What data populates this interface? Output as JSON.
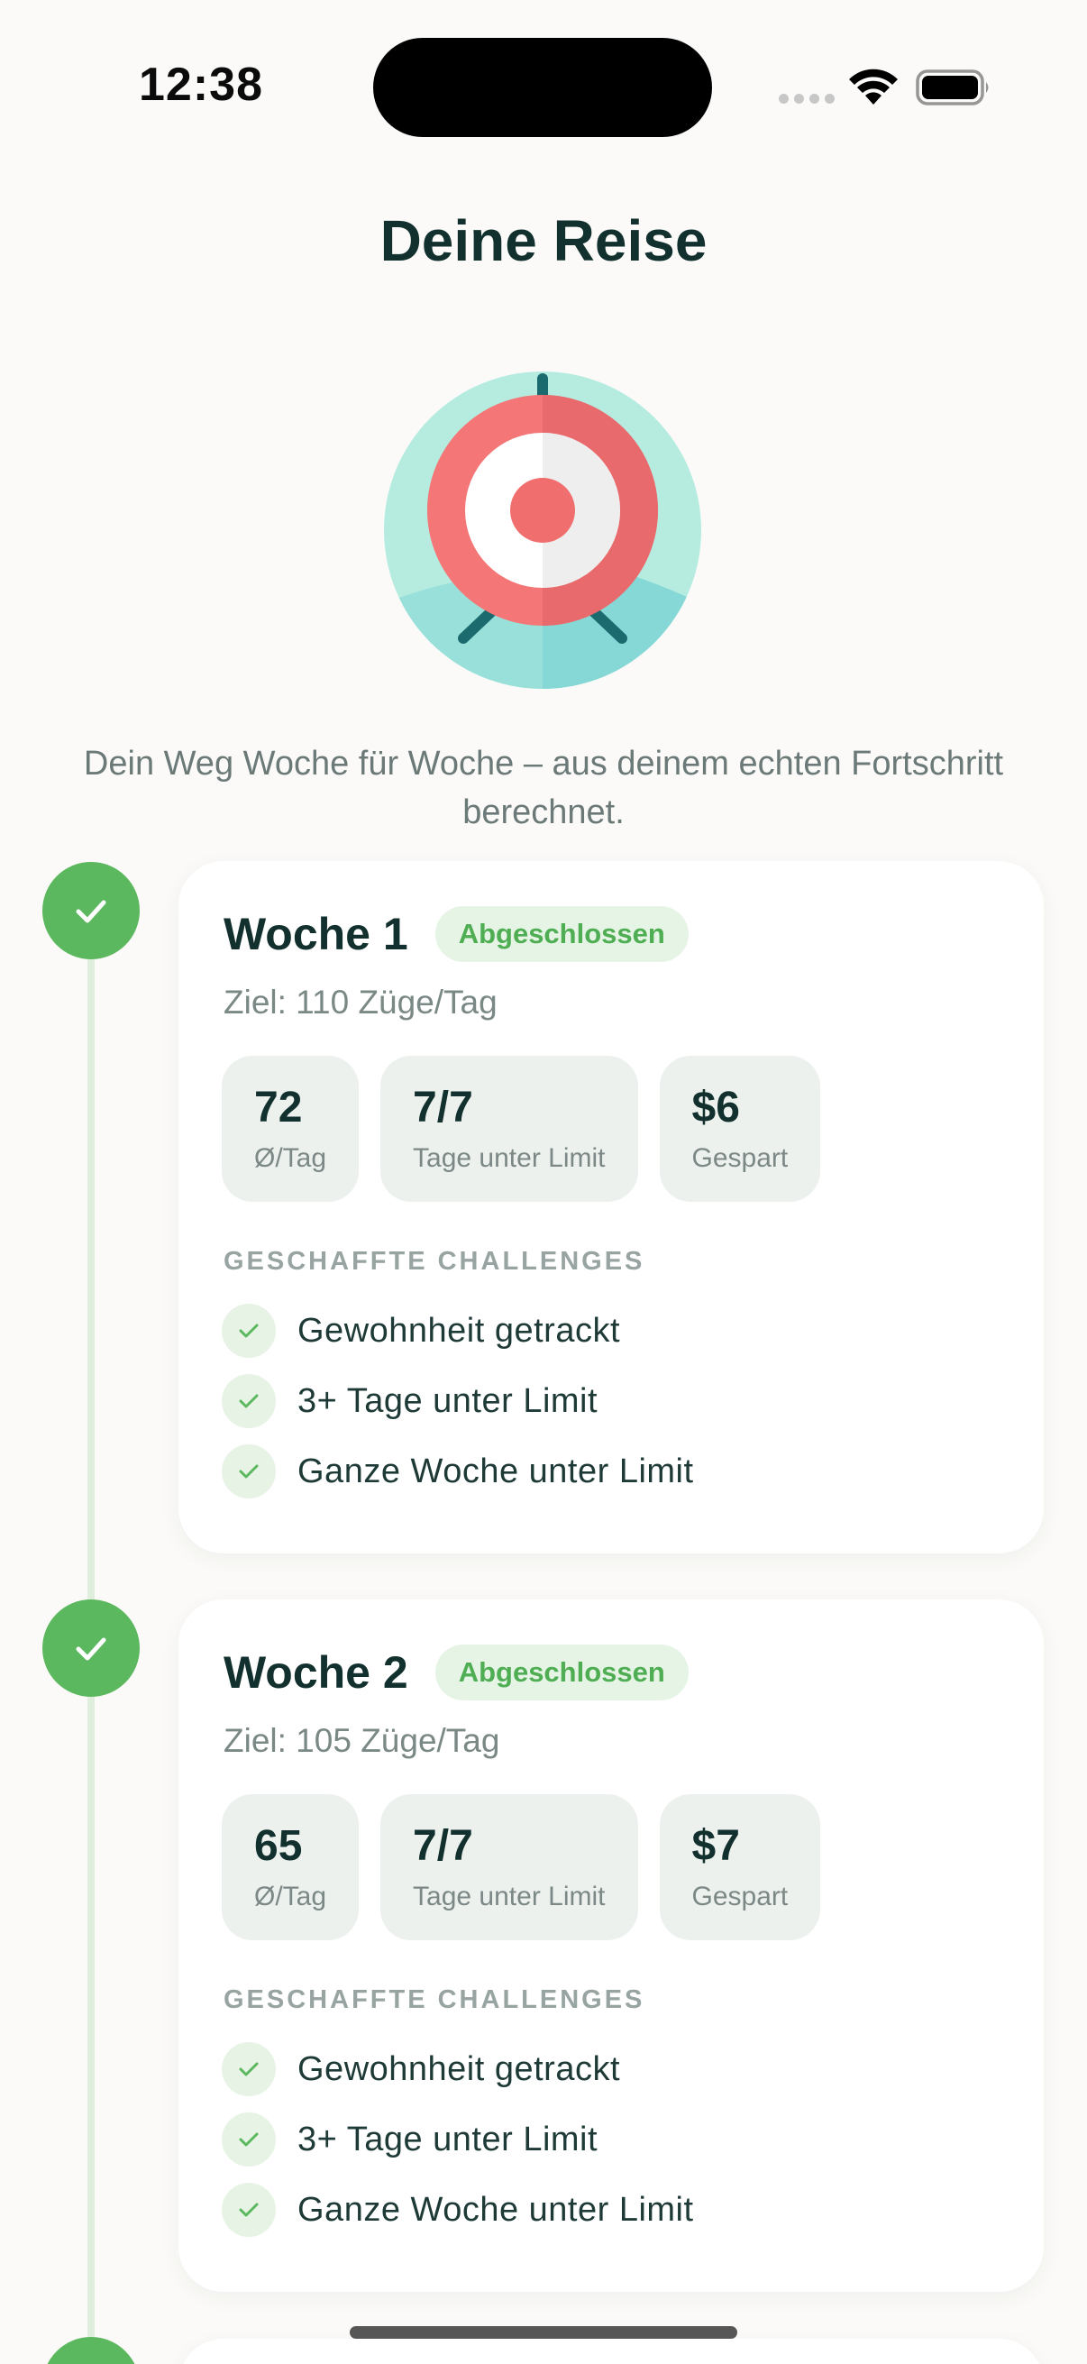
{
  "status_bar": {
    "time": "12:38"
  },
  "header": {
    "title": "Deine Reise"
  },
  "hero": {
    "icon": "target-icon"
  },
  "subtitle": "Dein Weg Woche für Woche – aus deinem echten Fortschritt berechnet.",
  "colors": {
    "accent_green": "#5cb85f",
    "badge_bg": "#e6f4e5",
    "target_red": "#f07171",
    "target_teal": "#b6ece0"
  },
  "weeks": [
    {
      "title": "Woche 1",
      "badge": "Abgeschlossen",
      "goal": "Ziel: 110 Züge/Tag",
      "stats": [
        {
          "value": "72",
          "label": "Ø/Tag"
        },
        {
          "value": "7/7",
          "label": "Tage unter Limit"
        },
        {
          "value": "$6",
          "label": "Gespart"
        }
      ],
      "challenges_label": "GESCHAFFTE CHALLENGES",
      "challenges": [
        "Gewohnheit getrackt",
        "3+ Tage unter Limit",
        "Ganze Woche unter Limit"
      ]
    },
    {
      "title": "Woche 2",
      "badge": "Abgeschlossen",
      "goal": "Ziel: 105 Züge/Tag",
      "stats": [
        {
          "value": "65",
          "label": "Ø/Tag"
        },
        {
          "value": "7/7",
          "label": "Tage unter Limit"
        },
        {
          "value": "$7",
          "label": "Gespart"
        }
      ],
      "challenges_label": "GESCHAFFTE CHALLENGES",
      "challenges": [
        "Gewohnheit getrackt",
        "3+ Tage unter Limit",
        "Ganze Woche unter Limit"
      ]
    }
  ]
}
